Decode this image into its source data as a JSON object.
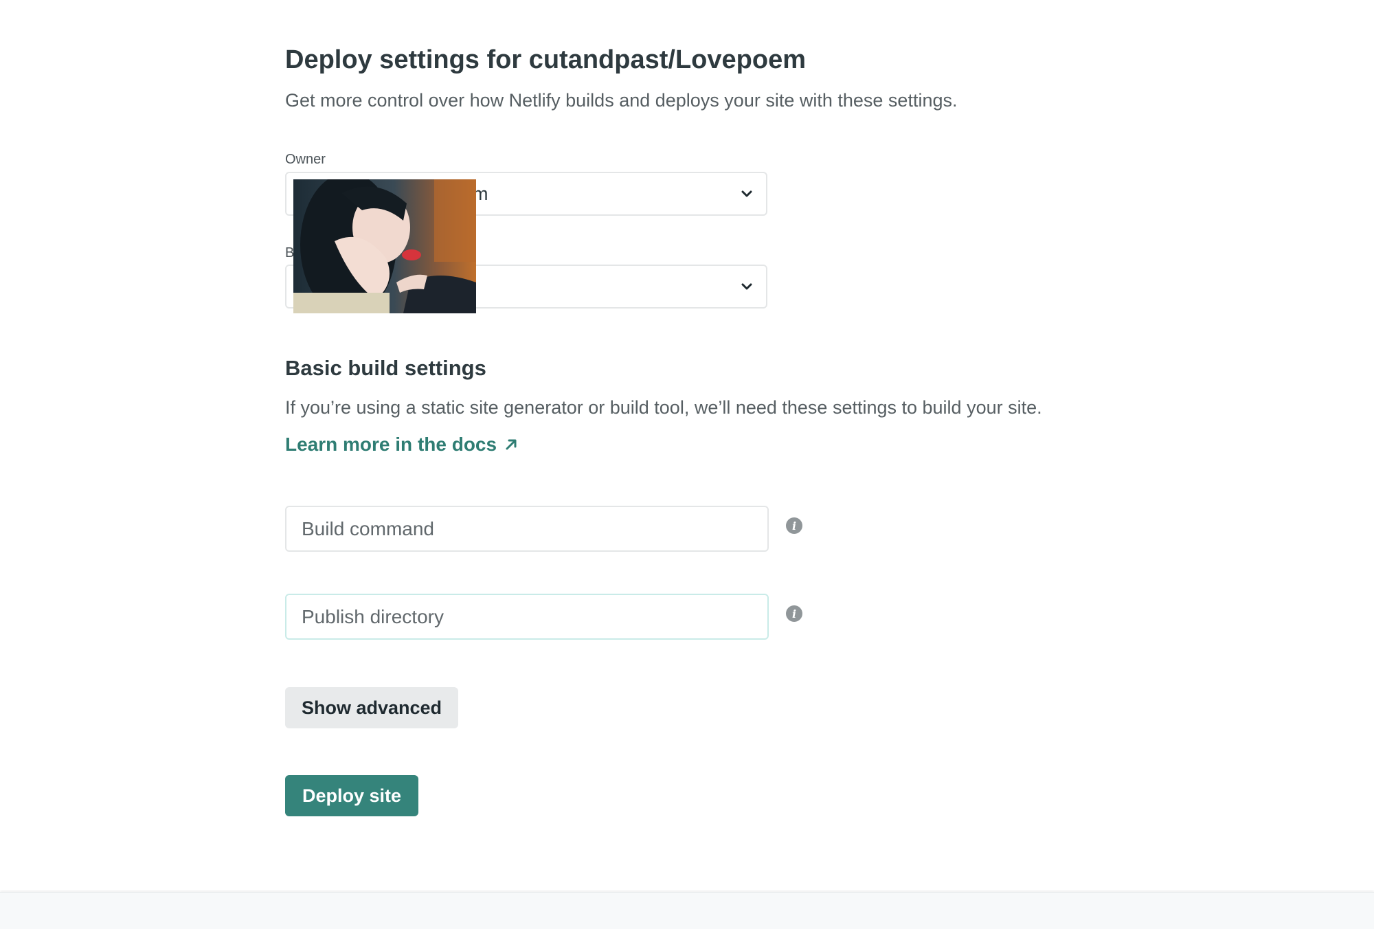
{
  "header": {
    "title": "Deploy settings for cutandpast/Lovepoem",
    "subtitle": "Get more control over how Netlify builds and deploys your site with these settings."
  },
  "owner": {
    "label": "Owner",
    "value": "am"
  },
  "branch": {
    "label": "B",
    "value": ""
  },
  "basic_build": {
    "title": "Basic build settings",
    "description": "If you’re using a static site generator or build tool, we’ll need these settings to build your site.",
    "docs_link": "Learn more in the docs",
    "build_command": {
      "placeholder": "Build command",
      "value": ""
    },
    "publish_directory": {
      "placeholder": "Publish directory",
      "value": ""
    }
  },
  "actions": {
    "show_advanced": "Show advanced",
    "deploy": "Deploy site"
  },
  "colors": {
    "accent": "#35847b",
    "link": "#2f7d73",
    "heading": "#2e3a3f"
  },
  "icons": {
    "dropdown": "chevron-down-icon",
    "info": "info-icon",
    "external": "arrow-up-right-icon"
  }
}
